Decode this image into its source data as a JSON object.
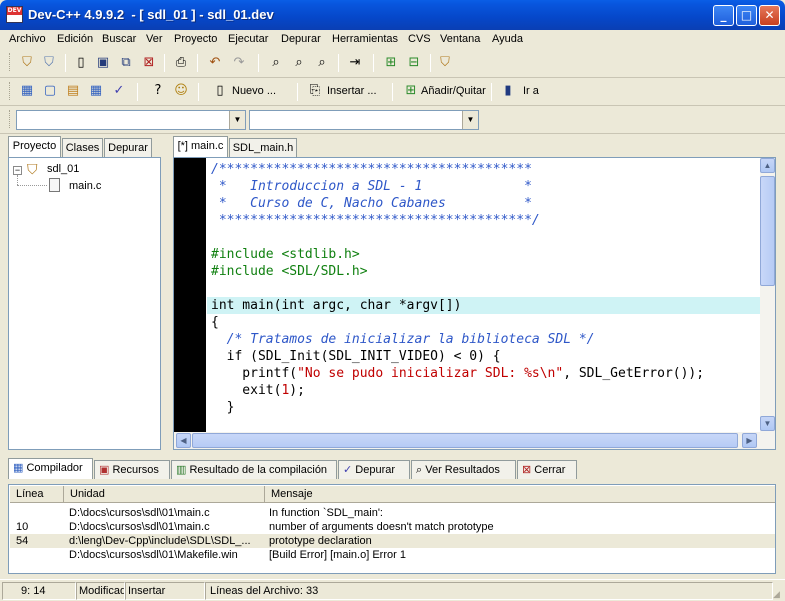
{
  "window": {
    "title": "Dev-C++ 4.9.9.2  - [ sdl_01 ] - sdl_01.dev",
    "minimize": "_",
    "maximize": "□",
    "close": "✕",
    "icon_text": "DEV"
  },
  "menu": [
    "Archivo",
    "Edición",
    "Buscar",
    "Ver",
    "Proyecto",
    "Ejecutar",
    "Depurar",
    "Herramientas",
    "CVS",
    "Ventana",
    "Ayuda"
  ],
  "toolbar2": {
    "nuevo": "Nuevo ...",
    "insertar": "Insertar ...",
    "anadir": "Añadir/Quitar",
    "ira": "Ir a"
  },
  "left_tabs": [
    "Proyecto",
    "Clases",
    "Depurar"
  ],
  "tree": {
    "root": "sdl_01",
    "child": "main.c"
  },
  "editor_tabs": [
    "[*] main.c",
    "SDL_main.h"
  ],
  "code": [
    "/****************************************",
    " *   Introduccion a SDL - 1             *",
    " *   Curso de C, Nacho Cabanes          *",
    " ****************************************/",
    "",
    "#include <stdlib.h>",
    "#include <SDL/SDL.h>",
    "",
    "int main(int argc, char *argv[])",
    "{",
    "  /* Tratamos de inicializar la biblioteca SDL */",
    "  if (SDL_Init(SDL_INIT_VIDEO) < 0) {",
    "    printf(",
    "\"No se pudo inicializar SDL: %s\\n\"",
    ", SDL_GetError());",
    "    exit(",
    "1",
    ");",
    "  }"
  ],
  "bottom_tabs": [
    "Compilador",
    "Recursos",
    "Resultado de la compilación",
    "Depurar",
    "Ver Resultados",
    "Cerrar"
  ],
  "grid": {
    "headers": [
      "Línea",
      "Unidad",
      "Mensaje"
    ],
    "rows": [
      {
        "linea": "",
        "unidad": "D:\\docs\\cursos\\sdl\\01\\main.c",
        "mensaje": "In function `SDL_main':"
      },
      {
        "linea": "10",
        "unidad": "D:\\docs\\cursos\\sdl\\01\\main.c",
        "mensaje": "number of arguments doesn't match prototype"
      },
      {
        "linea": "54",
        "unidad": "d:\\leng\\Dev-Cpp\\include\\SDL\\SDL_...",
        "mensaje": "prototype declaration"
      },
      {
        "linea": "",
        "unidad": "D:\\docs\\cursos\\sdl\\01\\Makefile.win",
        "mensaje": "[Build Error]  [main.o] Error 1"
      }
    ]
  },
  "status": {
    "pos": "9: 14",
    "mod": "Modificado",
    "mode": "Insertar",
    "lines": "Líneas del Archivo: 33"
  },
  "colors": {
    "comment": "#2e57c8",
    "preprocessor": "#108010",
    "string": "#c00000",
    "highlight_line": "#cff3f5",
    "gutter": "#000000"
  }
}
